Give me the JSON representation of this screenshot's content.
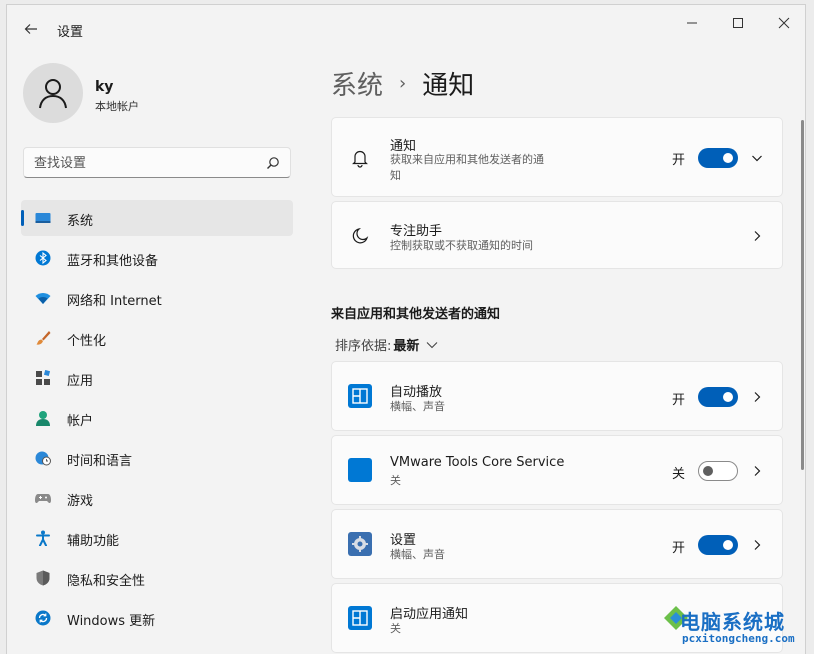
{
  "window": {
    "title": "设置"
  },
  "user": {
    "name": "ky",
    "account_type": "本地帐户"
  },
  "search": {
    "placeholder": "查找设置"
  },
  "sidebar": {
    "items": [
      {
        "label": "系统",
        "icon": "monitor-icon",
        "active": true
      },
      {
        "label": "蓝牙和其他设备",
        "icon": "bluetooth-icon"
      },
      {
        "label": "网络和 Internet",
        "icon": "wifi-icon"
      },
      {
        "label": "个性化",
        "icon": "brush-icon"
      },
      {
        "label": "应用",
        "icon": "apps-icon"
      },
      {
        "label": "帐户",
        "icon": "account-icon"
      },
      {
        "label": "时间和语言",
        "icon": "globe-clock-icon"
      },
      {
        "label": "游戏",
        "icon": "gamepad-icon"
      },
      {
        "label": "辅助功能",
        "icon": "accessibility-icon"
      },
      {
        "label": "隐私和安全性",
        "icon": "shield-icon"
      },
      {
        "label": "Windows 更新",
        "icon": "update-icon"
      }
    ]
  },
  "breadcrumb": {
    "parent": "系统",
    "separator": "›",
    "current": "通知"
  },
  "settings": {
    "notifications": {
      "title": "通知",
      "subtitle": "获取来自应用和其他发送者的通\n知",
      "state": "开",
      "on": true
    },
    "focus_assist": {
      "title": "专注助手",
      "subtitle": "控制获取或不获取通知的时间"
    }
  },
  "apps_section": {
    "title": "来自应用和其他发送者的通知",
    "sort_label": "排序依据:",
    "sort_value": "最新",
    "apps": [
      {
        "name": "自动播放",
        "detail": "横幅、声音",
        "state": "开",
        "on": true
      },
      {
        "name": "VMware Tools Core Service",
        "detail": "关",
        "state": "关",
        "on": false
      },
      {
        "name": "设置",
        "detail": "横幅、声音",
        "state": "开",
        "on": true
      },
      {
        "name": "启动应用通知",
        "detail": "关"
      }
    ]
  },
  "watermark": {
    "text": "电脑系统城",
    "url": "pcxitongcheng.com"
  },
  "colors": {
    "accent": "#005fb8",
    "background": "#f3f3f3",
    "card": "#fbfbfb"
  }
}
